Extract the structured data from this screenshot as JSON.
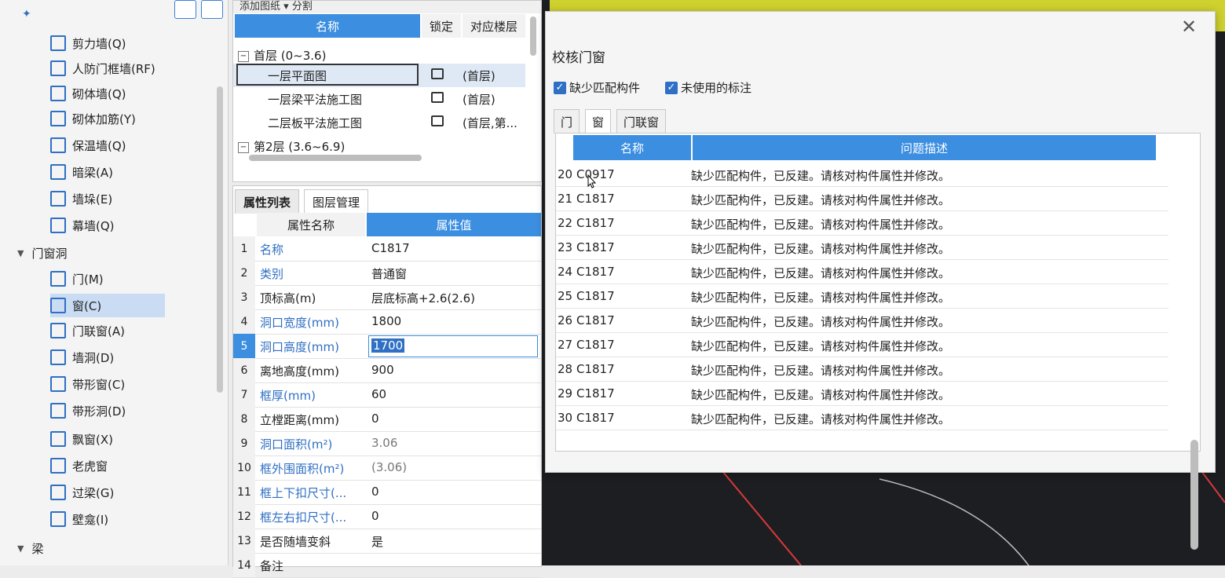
{
  "left": {
    "groups": [
      {
        "label": "门窗洞"
      },
      {
        "label": "梁"
      }
    ],
    "items": [
      {
        "label": "剪力墙(Q)",
        "icon": "shear-wall-icon"
      },
      {
        "label": "人防门框墙(RF)",
        "icon": "civil-defense-door-icon"
      },
      {
        "label": "砌体墙(Q)",
        "icon": "masonry-wall-icon"
      },
      {
        "label": "砌体加筋(Y)",
        "icon": "masonry-rebar-icon"
      },
      {
        "label": "保温墙(Q)",
        "icon": "insulation-wall-icon"
      },
      {
        "label": "暗梁(A)",
        "icon": "hidden-beam-icon"
      },
      {
        "label": "墙垛(E)",
        "icon": "wall-pier-icon"
      },
      {
        "label": "幕墙(Q)",
        "icon": "curtain-wall-icon"
      },
      {
        "label": "门(M)",
        "icon": "door-icon"
      },
      {
        "label": "窗(C)",
        "icon": "window-icon"
      },
      {
        "label": "门联窗(A)",
        "icon": "door-window-icon"
      },
      {
        "label": "墙洞(D)",
        "icon": "wall-hole-icon"
      },
      {
        "label": "带形窗(C)",
        "icon": "strip-window-icon"
      },
      {
        "label": "带形洞(D)",
        "icon": "strip-hole-icon"
      },
      {
        "label": "飘窗(X)",
        "icon": "bay-window-icon"
      },
      {
        "label": "老虎窗",
        "icon": "dormer-window-icon"
      },
      {
        "label": "过梁(G)",
        "icon": "lintel-icon"
      },
      {
        "label": "壁龛(I)",
        "icon": "niche-icon"
      }
    ]
  },
  "drawings": {
    "toolbar": "添加图纸 ▾   分割",
    "headers": {
      "name": "名称",
      "lock": "锁定",
      "floor": "对应楼层"
    },
    "rows": [
      {
        "name": "首层 (0~3.6)",
        "floor": ""
      },
      {
        "name": "一层平面图",
        "floor": "(首层)"
      },
      {
        "name": "一层梁平法施工图",
        "floor": "(首层)"
      },
      {
        "name": "二层板平法施工图",
        "floor": "(首层,第..."
      },
      {
        "name": "第2层 (3.6~6.9)",
        "floor": ""
      }
    ]
  },
  "props": {
    "tabs": [
      "属性列表",
      "图层管理"
    ],
    "headers": {
      "name": "属性名称",
      "value": "属性值"
    },
    "rows": [
      {
        "idx": "1",
        "name": "名称",
        "value": "C1817"
      },
      {
        "idx": "2",
        "name": "类别",
        "value": "普通窗"
      },
      {
        "idx": "3",
        "name": "顶标高(m)",
        "value": "层底标高+2.6(2.6)"
      },
      {
        "idx": "4",
        "name": "洞口宽度(mm)",
        "value": "1800"
      },
      {
        "idx": "5",
        "name": "洞口高度(mm)",
        "value": "1700"
      },
      {
        "idx": "6",
        "name": "离地高度(mm)",
        "value": "900"
      },
      {
        "idx": "7",
        "name": "框厚(mm)",
        "value": "60"
      },
      {
        "idx": "8",
        "name": "立樘距离(mm)",
        "value": "0"
      },
      {
        "idx": "9",
        "name": "洞口面积(m²)",
        "value": "3.06"
      },
      {
        "idx": "10",
        "name": "框外围面积(m²)",
        "value": "(3.06)"
      },
      {
        "idx": "11",
        "name": "框上下扣尺寸(...",
        "value": "0"
      },
      {
        "idx": "12",
        "name": "框左右扣尺寸(...",
        "value": "0"
      },
      {
        "idx": "13",
        "name": "是否随墙变斜",
        "value": "是"
      },
      {
        "idx": "14",
        "name": "备注",
        "value": ""
      }
    ]
  },
  "dialog": {
    "title": "校核门窗",
    "close": "✕",
    "checkbox1": "缺少匹配构件",
    "checkbox2": "未使用的标注",
    "check_mark": "✓",
    "tabs": [
      "门",
      "窗",
      "门联窗"
    ],
    "headers": {
      "name": "名称",
      "desc": "问题描述"
    },
    "rows": [
      {
        "idx": "20",
        "name": "C0917",
        "desc": "缺少匹配构件，已反建。请核对构件属性并修改。"
      },
      {
        "idx": "21",
        "name": "C1817",
        "desc": "缺少匹配构件，已反建。请核对构件属性并修改。"
      },
      {
        "idx": "22",
        "name": "C1817",
        "desc": "缺少匹配构件，已反建。请核对构件属性并修改。"
      },
      {
        "idx": "23",
        "name": "C1817",
        "desc": "缺少匹配构件，已反建。请核对构件属性并修改。"
      },
      {
        "idx": "24",
        "name": "C1817",
        "desc": "缺少匹配构件，已反建。请核对构件属性并修改。"
      },
      {
        "idx": "25",
        "name": "C1817",
        "desc": "缺少匹配构件，已反建。请核对构件属性并修改。"
      },
      {
        "idx": "26",
        "name": "C1817",
        "desc": "缺少匹配构件，已反建。请核对构件属性并修改。"
      },
      {
        "idx": "27",
        "name": "C1817",
        "desc": "缺少匹配构件，已反建。请核对构件属性并修改。"
      },
      {
        "idx": "28",
        "name": "C1817",
        "desc": "缺少匹配构件，已反建。请核对构件属性并修改。"
      },
      {
        "idx": "29",
        "name": "C1817",
        "desc": "缺少匹配构件，已反建。请核对构件属性并修改。"
      },
      {
        "idx": "30",
        "name": "C1817",
        "desc": "缺少匹配构件，已反建。请核对构件属性并修改。"
      }
    ]
  },
  "colors": {
    "accent": "#3b8ee0",
    "scene_bg": "#1d1e22",
    "scene_yellow": "#cfd12e"
  }
}
